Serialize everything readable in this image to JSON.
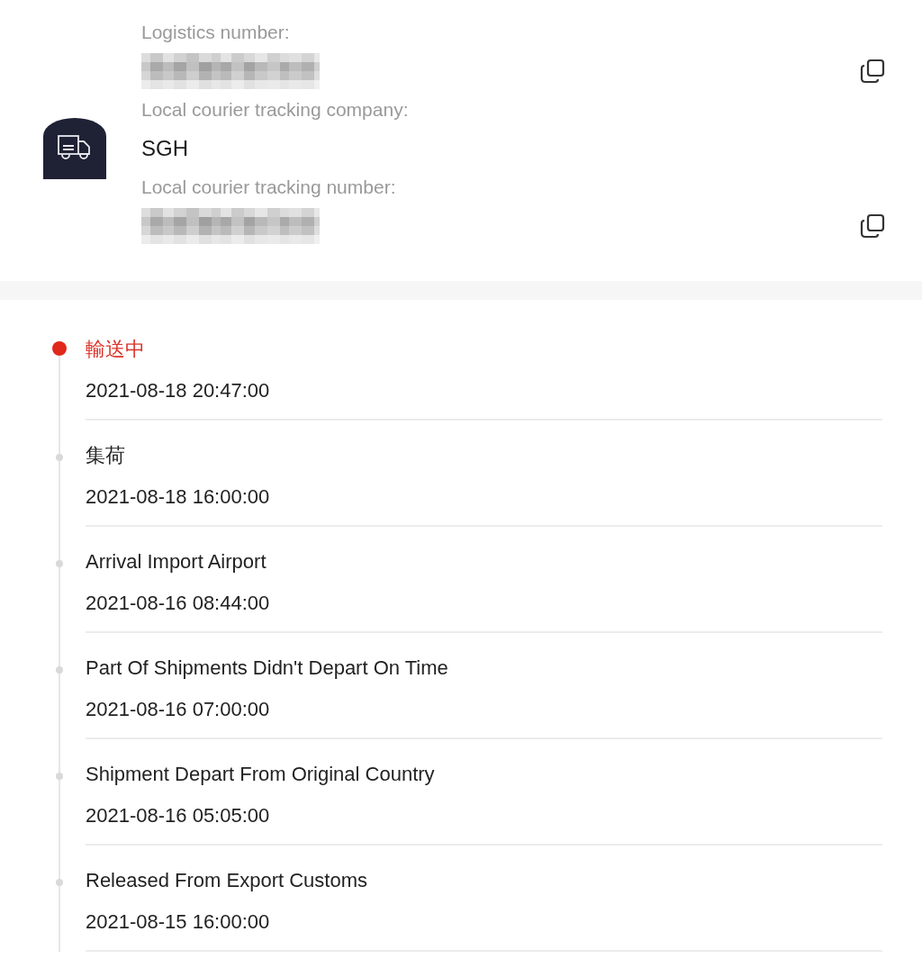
{
  "shipment": {
    "fields": [
      {
        "label": "Logistics number:",
        "redacted": true,
        "copyable": true
      },
      {
        "label": "Local courier tracking company:",
        "redacted": false,
        "value": "SGH",
        "copyable": false
      },
      {
        "label": "Local courier tracking number:",
        "redacted": true,
        "copyable": true
      }
    ]
  },
  "timeline": [
    {
      "title": "輸送中",
      "time": "2021-08-18 20:47:00",
      "current": true
    },
    {
      "title": "集荷",
      "time": "2021-08-18 16:00:00",
      "current": false
    },
    {
      "title": "Arrival Import Airport",
      "time": "2021-08-16 08:44:00",
      "current": false
    },
    {
      "title": "Part Of Shipments Didn't Depart On Time",
      "time": "2021-08-16 07:00:00",
      "current": false
    },
    {
      "title": "Shipment Depart From Original Country",
      "time": "2021-08-16 05:05:00",
      "current": false
    },
    {
      "title": "Released From Export Customs",
      "time": "2021-08-15 16:00:00",
      "current": false
    }
  ]
}
